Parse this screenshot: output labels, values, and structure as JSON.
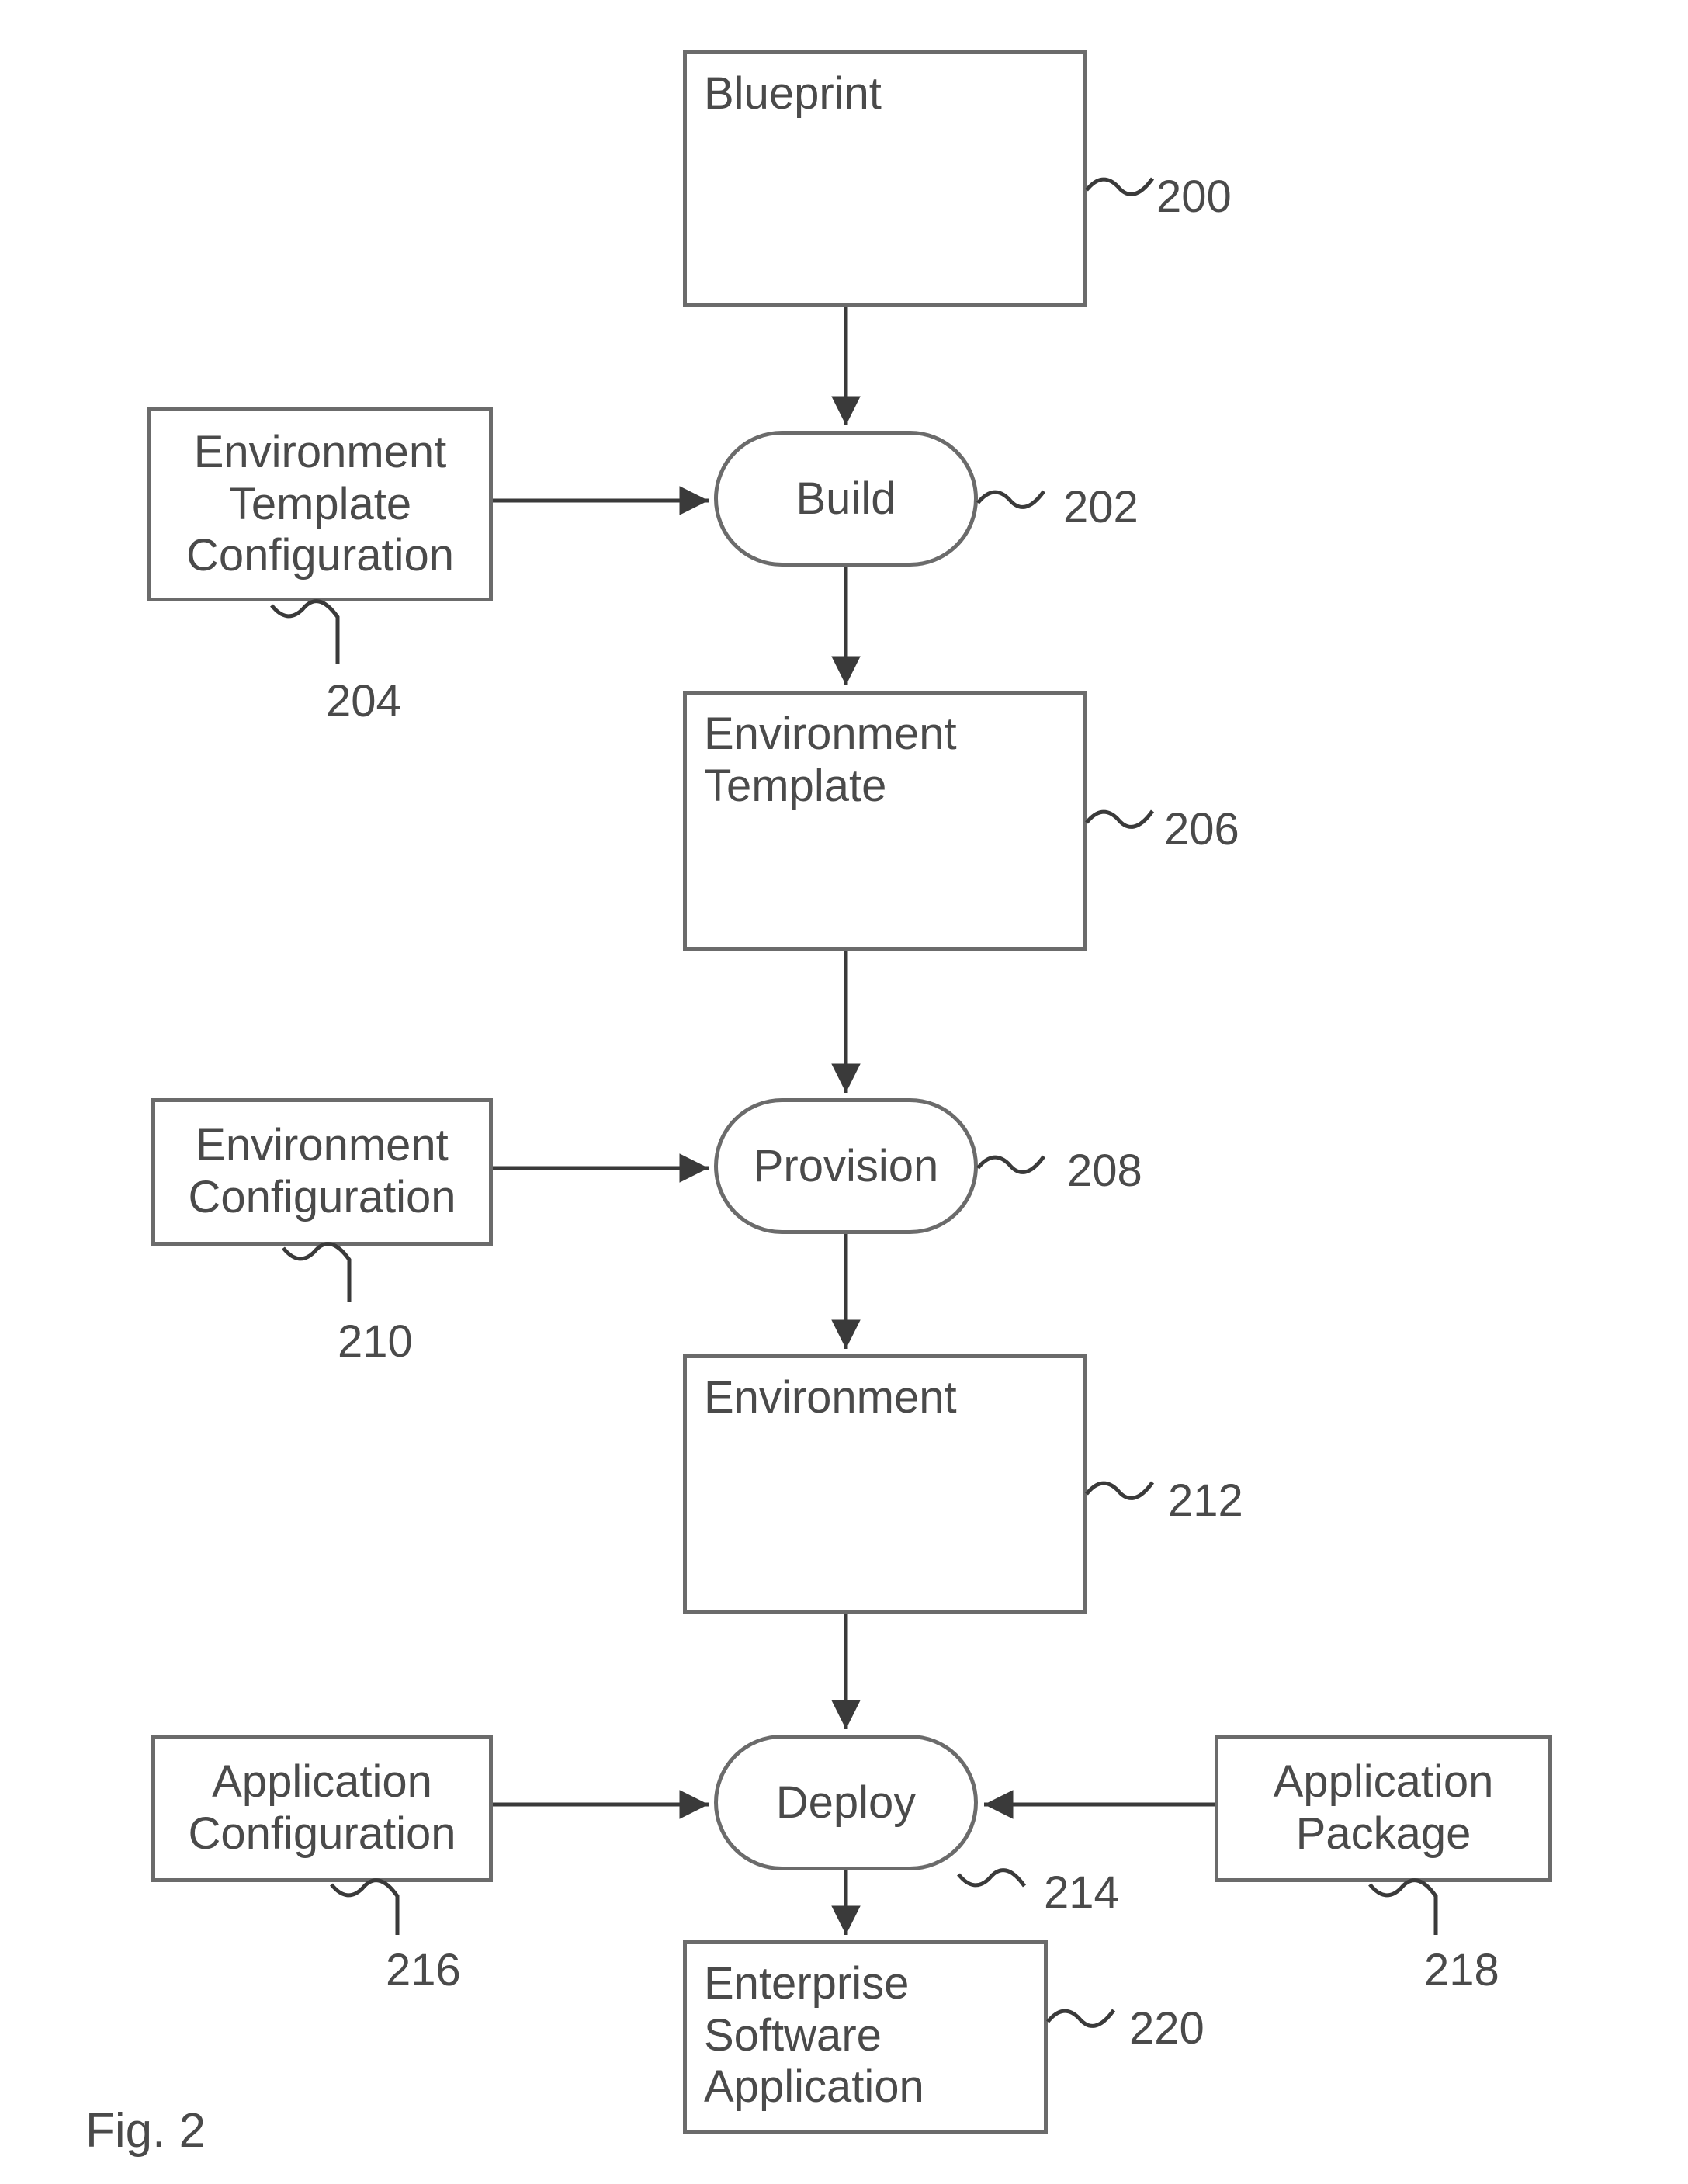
{
  "figure": {
    "label": "Fig. 2"
  },
  "nodes": {
    "blueprint": {
      "label": "Blueprint",
      "ref": "200"
    },
    "build": {
      "label": "Build",
      "ref": "202"
    },
    "envTplCfg": {
      "label": "Environment\nTemplate\nConfiguration",
      "ref": "204"
    },
    "envTpl": {
      "label": "Environment\nTemplate",
      "ref": "206"
    },
    "provision": {
      "label": "Provision",
      "ref": "208"
    },
    "envCfg": {
      "label": "Environment\nConfiguration",
      "ref": "210"
    },
    "env": {
      "label": "Environment",
      "ref": "212"
    },
    "deploy": {
      "label": "Deploy",
      "ref": "214"
    },
    "appCfg": {
      "label": "Application\nConfiguration",
      "ref": "216"
    },
    "appPkg": {
      "label": "Application\nPackage",
      "ref": "218"
    },
    "entApp": {
      "label": "Enterprise\nSoftware\nApplication",
      "ref": "220"
    }
  }
}
